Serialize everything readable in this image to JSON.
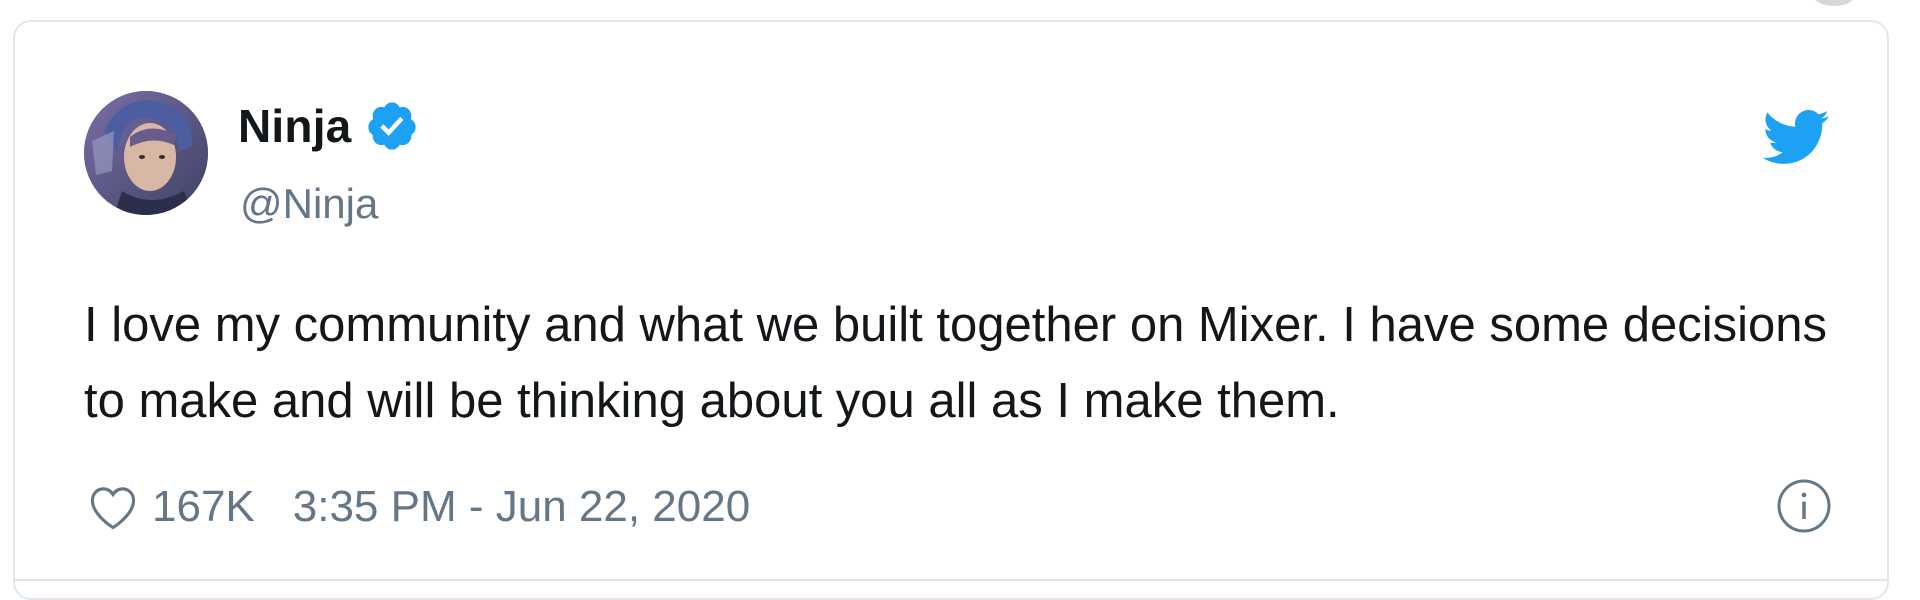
{
  "tweet": {
    "author": {
      "display_name": "Ninja",
      "handle": "@Ninja",
      "verified": true,
      "avatar_icon": "avatar-photo"
    },
    "text": "I love my community and what we built together on Mixer. I have some decisions to make and will be thinking about you all as I make them.",
    "likes": "167K",
    "timestamp": "3:35 PM - Jun 22, 2020"
  },
  "icons": {
    "brand": "twitter-bird-icon",
    "verified": "verified-badge-icon",
    "like": "heart-icon",
    "info": "info-icon"
  },
  "colors": {
    "brand_blue": "#1da1f2",
    "text_primary": "#14171a",
    "text_secondary": "#657786",
    "border": "#e1e8ed"
  }
}
